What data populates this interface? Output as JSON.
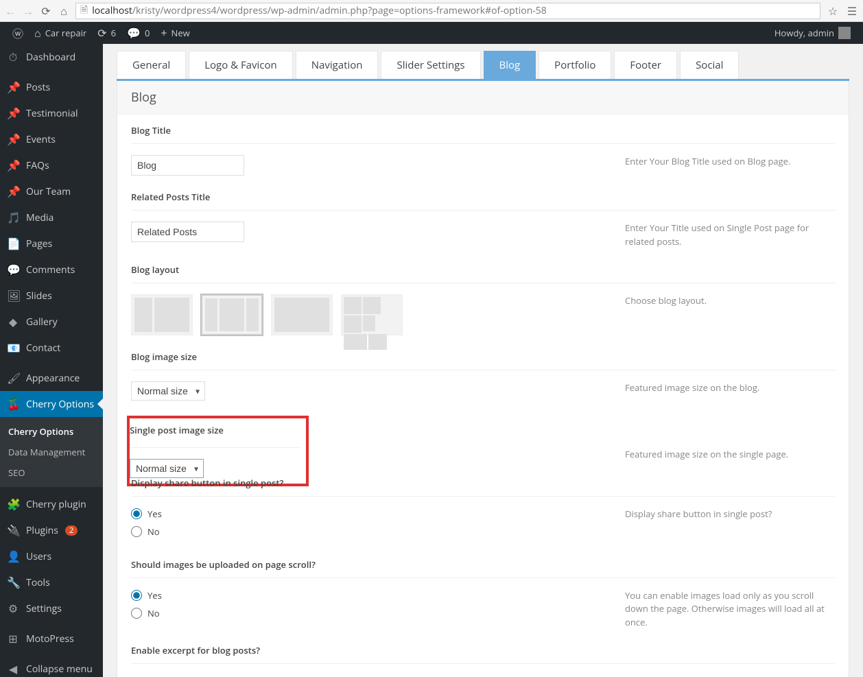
{
  "browser": {
    "url_host": "localhost",
    "url_path": "/kristy/wordpress4/wordpress/wp-admin/admin.php?page=options-framework#of-option-58"
  },
  "adminbar": {
    "site_name": "Car repair",
    "updates": "6",
    "comments": "0",
    "new": "New",
    "howdy": "Howdy, admin"
  },
  "sidebar": {
    "items": [
      {
        "icon": "dashboard-icon",
        "glyph": "⏱",
        "label": "Dashboard"
      },
      {
        "icon": "pin-icon",
        "glyph": "📌",
        "label": "Posts"
      },
      {
        "icon": "pin-icon",
        "glyph": "📌",
        "label": "Testimonial"
      },
      {
        "icon": "pin-icon",
        "glyph": "📌",
        "label": "Events"
      },
      {
        "icon": "pin-icon",
        "glyph": "📌",
        "label": "FAQs"
      },
      {
        "icon": "pin-icon",
        "glyph": "📌",
        "label": "Our Team"
      },
      {
        "icon": "media-icon",
        "glyph": "🎵",
        "label": "Media"
      },
      {
        "icon": "page-icon",
        "glyph": "📄",
        "label": "Pages"
      },
      {
        "icon": "comment-icon",
        "glyph": "💬",
        "label": "Comments"
      },
      {
        "icon": "slides-icon",
        "glyph": "🖼",
        "label": "Slides"
      },
      {
        "icon": "gallery-icon",
        "glyph": "◆",
        "label": "Gallery"
      },
      {
        "icon": "contact-icon",
        "glyph": "📧",
        "label": "Contact"
      },
      {
        "icon": "appearance-icon",
        "glyph": "🖌",
        "label": "Appearance"
      },
      {
        "icon": "cherry-icon",
        "glyph": "🍒",
        "label": "Cherry Options",
        "current": true
      },
      {
        "icon": "cherry-plugin-icon",
        "glyph": "🧩",
        "label": "Cherry plugin"
      },
      {
        "icon": "plugins-icon",
        "glyph": "🔌",
        "label": "Plugins",
        "badge": "2"
      },
      {
        "icon": "users-icon",
        "glyph": "👤",
        "label": "Users"
      },
      {
        "icon": "tools-icon",
        "glyph": "🔧",
        "label": "Tools"
      },
      {
        "icon": "settings-icon",
        "glyph": "⚙",
        "label": "Settings"
      },
      {
        "icon": "motopress-icon",
        "glyph": "⊞",
        "label": "MotoPress"
      },
      {
        "icon": "collapse-icon",
        "glyph": "◀",
        "label": "Collapse menu"
      }
    ],
    "submenu": [
      {
        "label": "Cherry Options",
        "active": true
      },
      {
        "label": "Data Management"
      },
      {
        "label": "SEO"
      }
    ]
  },
  "tabs": [
    {
      "label": "General"
    },
    {
      "label": "Logo & Favicon"
    },
    {
      "label": "Navigation"
    },
    {
      "label": "Slider Settings"
    },
    {
      "label": "Blog",
      "active": true
    },
    {
      "label": "Portfolio"
    },
    {
      "label": "Footer"
    },
    {
      "label": "Social"
    }
  ],
  "panel": {
    "title": "Blog",
    "blog_title": {
      "label": "Blog Title",
      "value": "Blog",
      "desc": "Enter Your Blog Title used on Blog page."
    },
    "related_posts": {
      "label": "Related Posts Title",
      "value": "Related Posts",
      "desc": "Enter Your Title used on Single Post page for related posts."
    },
    "blog_layout": {
      "label": "Blog layout",
      "desc": "Choose blog layout."
    },
    "blog_image_size": {
      "label": "Blog image size",
      "value": "Normal size",
      "desc": "Featured image size on the blog."
    },
    "single_image_size": {
      "label": "Single post image size",
      "value": "Normal size",
      "desc": "Featured image size on the single page."
    },
    "share_button": {
      "label": "Display share button in single post?",
      "yes": "Yes",
      "no": "No",
      "desc": "Display share button in single post?"
    },
    "lazy_images": {
      "label": "Should images be uploaded on page scroll?",
      "yes": "Yes",
      "no": "No",
      "desc": "You can enable images load only as you scroll down the page. Otherwise images will load all at once."
    },
    "excerpt": {
      "label": "Enable excerpt for blog posts?"
    }
  }
}
